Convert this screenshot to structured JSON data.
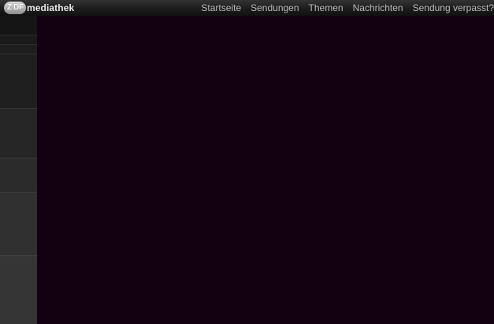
{
  "header": {
    "logo": {
      "mark_text": "ZDF",
      "text": "mediathek"
    },
    "nav": [
      {
        "label": "Startseite"
      },
      {
        "label": "Sendungen"
      },
      {
        "label": "Themen"
      },
      {
        "label": "Nachrichten"
      },
      {
        "label": "Sendung verpasst?"
      }
    ]
  },
  "colors": {
    "topbar": "#1c1c1c",
    "nav_text": "#b9b9b9",
    "logo_text": "#e8e8e8",
    "main_bg": "#130010",
    "sidebar_bg": "#121212"
  }
}
